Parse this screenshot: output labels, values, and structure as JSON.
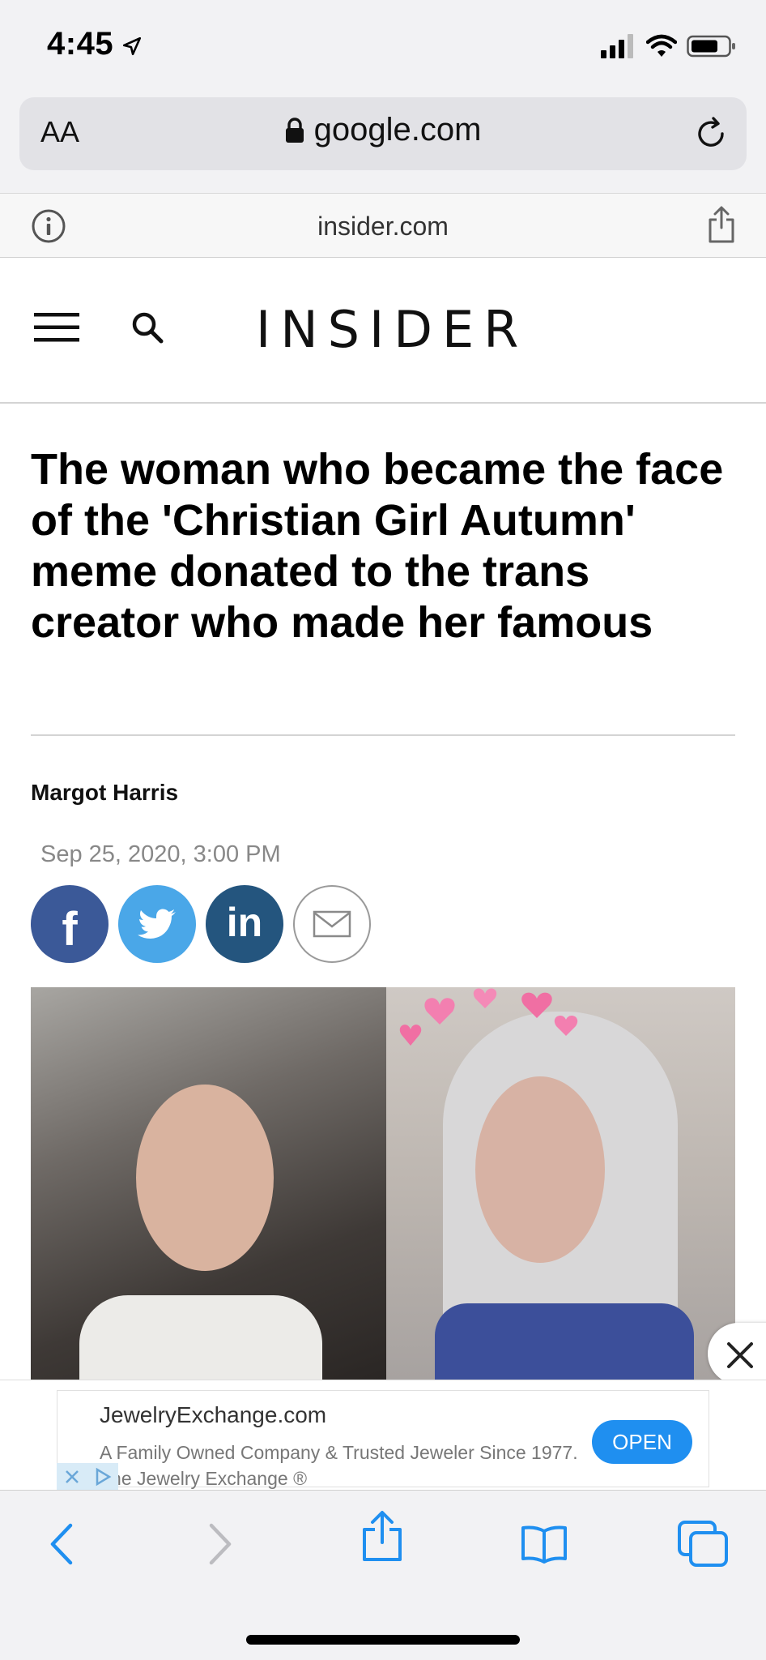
{
  "status_bar": {
    "time": "4:45"
  },
  "url_bar": {
    "aa_label": "AA",
    "domain": "google.com"
  },
  "sub_bar": {
    "domain": "insider.com"
  },
  "site": {
    "logo": "INSIDER"
  },
  "article": {
    "headline": "The woman who became the face of the 'Christian Girl Autumn' meme donated to the trans creator who made her famous",
    "author": "Margot Harris",
    "date": "Sep 25, 2020, 3:00 PM",
    "share": {
      "facebook": "f",
      "linkedin": "in"
    }
  },
  "ad": {
    "title": "JewelryExchange.com",
    "body": "A Family Owned Company & Trusted Jeweler Since 1977. The Jewelry Exchange ®",
    "cta": "OPEN"
  },
  "colors": {
    "facebook": "#3b5998",
    "twitter": "#4aa7e8",
    "linkedin": "#24557e",
    "ios_blue": "#1f8ff0"
  }
}
